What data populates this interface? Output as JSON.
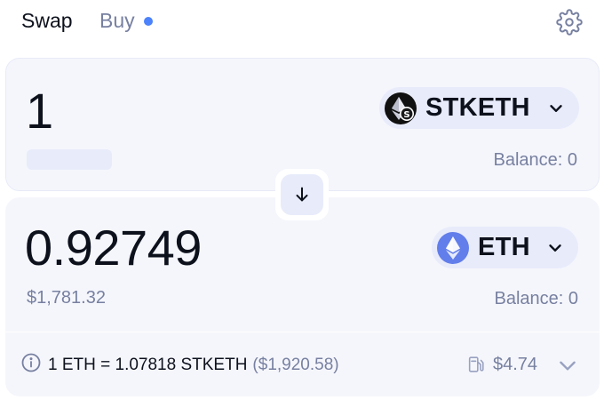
{
  "header": {
    "tabs": [
      {
        "label": "Swap",
        "active": true
      },
      {
        "label": "Buy",
        "active": false,
        "has_dot": true
      }
    ],
    "settings_icon": "gear-icon"
  },
  "input": {
    "amount": "1",
    "token": {
      "symbol": "STKETH",
      "icon": "stketh-logo-icon"
    },
    "balance": "Balance: 0"
  },
  "output": {
    "amount": "0.92749",
    "usd_value": "$1,781.32",
    "token": {
      "symbol": "ETH",
      "icon": "eth-logo-icon"
    },
    "balance": "Balance: 0"
  },
  "switch_icon": "arrow-down-icon",
  "rate": {
    "text": "1 ETH = 1.07818 STKETH",
    "usd": "($1,920.58)",
    "gas": "$4.74"
  },
  "colors": {
    "accent": "#4c82fb",
    "panel_bg": "#f5f6fc",
    "token_bg": "#e8ebfa",
    "muted_text": "#7780a0",
    "primary_text": "#0d111c"
  }
}
